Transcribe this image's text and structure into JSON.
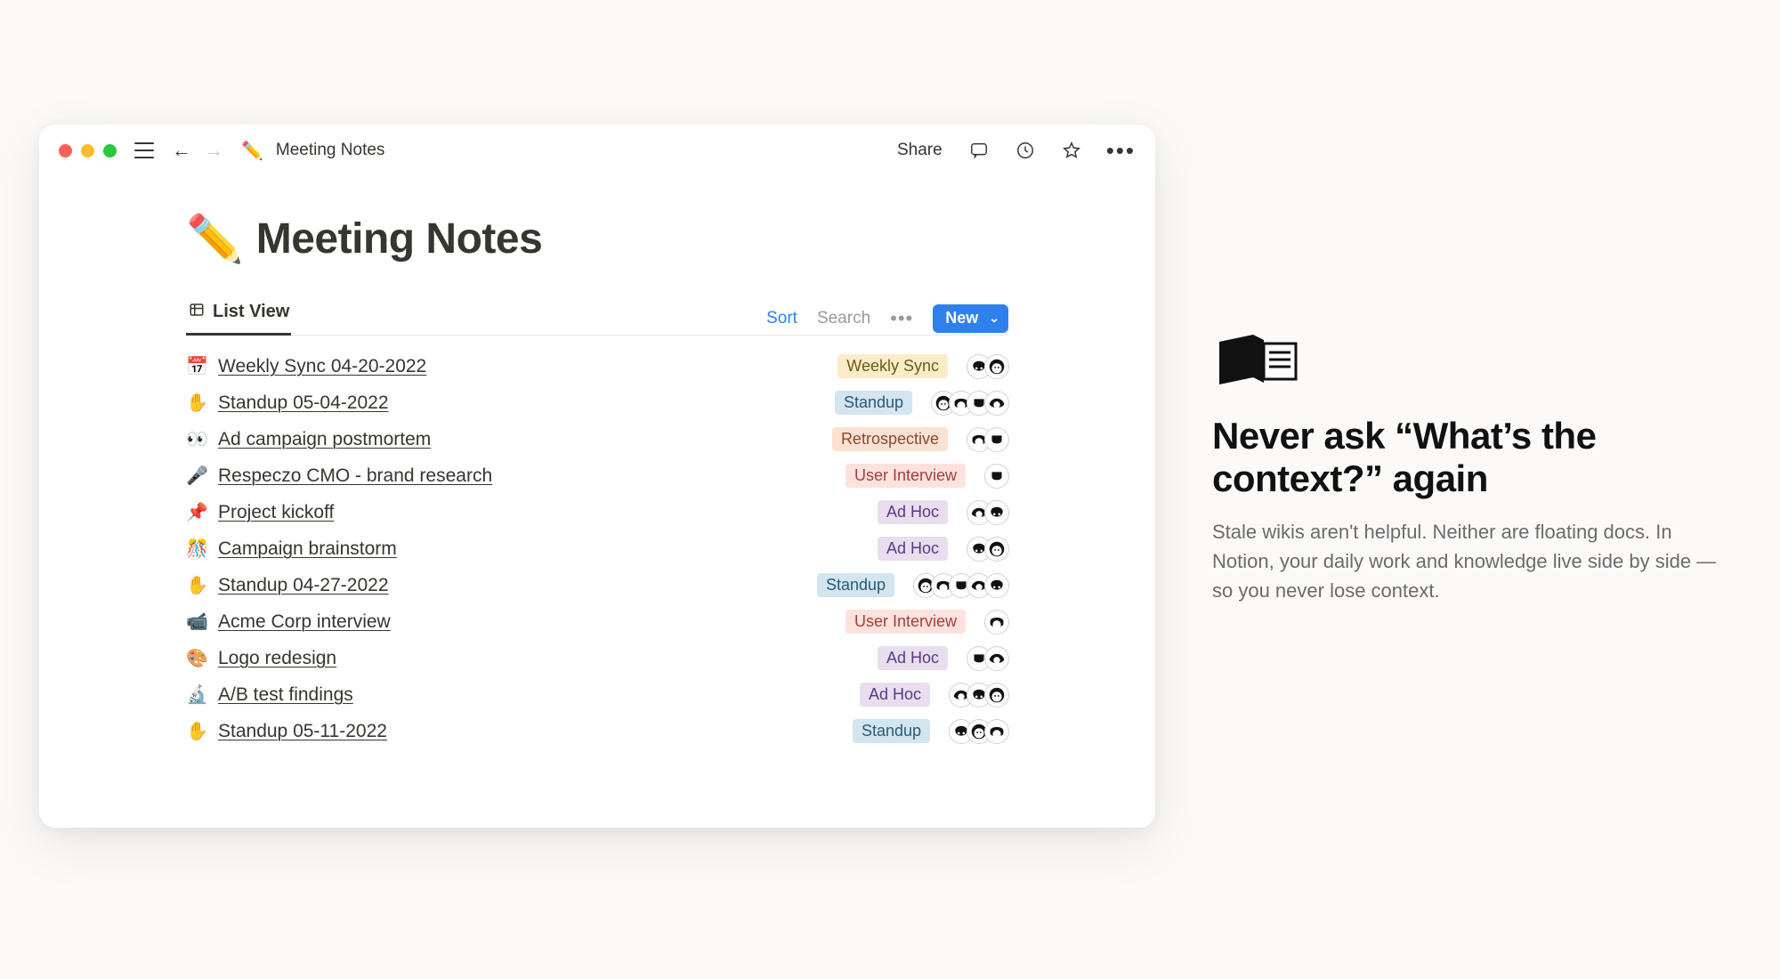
{
  "window": {
    "breadcrumb_emoji": "✏️",
    "breadcrumb_text": "Meeting Notes",
    "share_label": "Share"
  },
  "page": {
    "title_emoji": "✏️",
    "title": "Meeting Notes"
  },
  "viewbar": {
    "tab_label": "List View",
    "sort_label": "Sort",
    "search_label": "Search",
    "new_label": "New"
  },
  "tags": {
    "weekly-sync": "Weekly Sync",
    "standup": "Standup",
    "retrospective": "Retrospective",
    "user-interview": "User Interview",
    "ad-hoc": "Ad Hoc"
  },
  "rows": [
    {
      "emoji": "📅",
      "title": "Weekly Sync 04-20-2022",
      "tag": "weekly-sync",
      "avatars": 2
    },
    {
      "emoji": "✋",
      "title": "Standup 05-04-2022",
      "tag": "standup",
      "avatars": 4
    },
    {
      "emoji": "👀",
      "title": "Ad campaign postmortem",
      "tag": "retrospective",
      "avatars": 2
    },
    {
      "emoji": "🎤",
      "title": "Respeczo CMO - brand research",
      "tag": "user-interview",
      "avatars": 1
    },
    {
      "emoji": "📌",
      "title": "Project kickoff",
      "tag": "ad-hoc",
      "avatars": 2
    },
    {
      "emoji": "🎊",
      "title": "Campaign brainstorm",
      "tag": "ad-hoc",
      "avatars": 2
    },
    {
      "emoji": "✋",
      "title": "Standup 04-27-2022",
      "tag": "standup",
      "avatars": 5
    },
    {
      "emoji": "📹",
      "title": "Acme Corp interview",
      "tag": "user-interview",
      "avatars": 1
    },
    {
      "emoji": "🎨",
      "title": "Logo redesign",
      "tag": "ad-hoc",
      "avatars": 2
    },
    {
      "emoji": "🔬",
      "title": "A/B test findings",
      "tag": "ad-hoc",
      "avatars": 3
    },
    {
      "emoji": "✋",
      "title": "Standup 05-11-2022",
      "tag": "standup",
      "avatars": 3
    }
  ],
  "promo": {
    "heading": "Never ask “What’s the context?” again",
    "body": "Stale wikis aren't helpful. Neither are floating docs. In Notion, your daily work and knowledge live side by side — so you never lose context."
  }
}
